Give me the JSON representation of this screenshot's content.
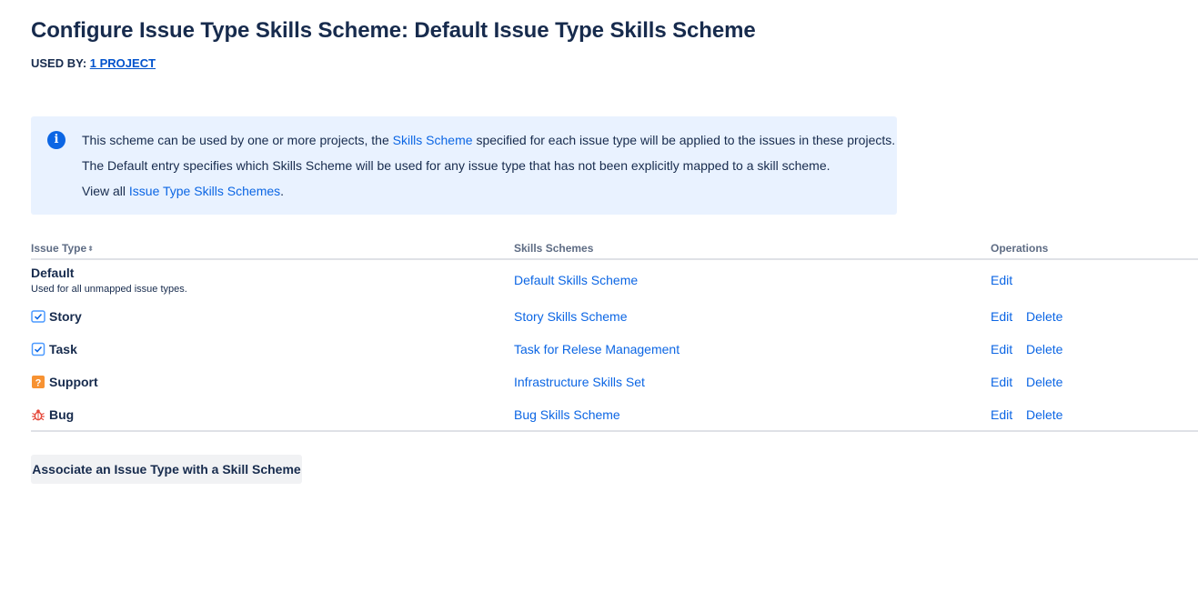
{
  "page": {
    "title": "Configure Issue Type Skills Scheme: Default Issue Type Skills Scheme",
    "used_by_label": "USED BY:",
    "used_by_link": "1 PROJECT"
  },
  "info": {
    "line1_pre": "This scheme can be used by one or more projects, the",
    "line1_link": "Skills Scheme",
    "line1_post": "specified for each issue type will be applied to the issues in these projects.",
    "line2": "The Default entry specifies which Skills Scheme will be used for any issue type that has not been explicitly mapped to a skill scheme.",
    "line3_pre": "View all",
    "line3_link": "Issue Type Skills Schemes",
    "line3_post": "."
  },
  "table": {
    "headers": {
      "issue_type": "Issue Type",
      "skills_schemes": "Skills Schemes",
      "operations": "Operations"
    },
    "rows": [
      {
        "type": "Default",
        "subtext": "Used for all unmapped issue types.",
        "scheme": "Default Skills Scheme",
        "edit": "Edit"
      },
      {
        "type": "Story",
        "icon": "story-icon",
        "scheme": "Story Skills Scheme",
        "edit": "Edit",
        "delete": "Delete"
      },
      {
        "type": "Task",
        "icon": "task-icon",
        "scheme": "Task for Relese Management",
        "edit": "Edit",
        "delete": "Delete"
      },
      {
        "type": "Support",
        "icon": "support-icon",
        "scheme": "Infrastructure Skills Set",
        "edit": "Edit",
        "delete": "Delete"
      },
      {
        "type": "Bug",
        "icon": "bug-icon",
        "scheme": "Bug Skills Scheme",
        "edit": "Edit",
        "delete": "Delete"
      }
    ]
  },
  "actions": {
    "associate_button": "Associate an Issue Type with a Skill Scheme"
  },
  "colors": {
    "link": "#0c66e4",
    "info_bg": "#e9f2ff",
    "support_icon": "#f79232",
    "bug_icon": "#e5493a"
  }
}
